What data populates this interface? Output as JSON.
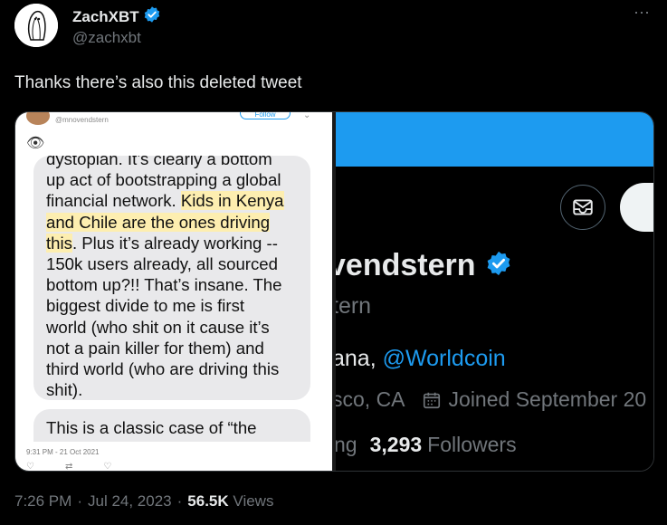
{
  "author": {
    "name": "ZachXBT",
    "handle": "@zachxbt",
    "verified": true
  },
  "tweet": {
    "text": "Thanks there’s also this deleted tweet",
    "time": "7:26 PM",
    "sep1": "·",
    "date": "Jul 24, 2023",
    "sep2": "·",
    "views_count": "56.5K",
    "views_label": "Views"
  },
  "more_icon": "⋯",
  "media_left": {
    "handle": "@mnovendstern",
    "follow_label": "Follow",
    "chevron": "⌄",
    "eye_icon": "👁",
    "bubble_lines": {
      "l1": "dystopian. It’s clearly a bottom",
      "l2": "up act of bootstrapping a global",
      "l3a": "financial network. ",
      "l3b": "Kids in Kenya",
      "l4": "and Chile are the ones driving",
      "l5a": "this",
      "l5b": ". Plus it’s already working --",
      "l6": "150k users already, all sourced",
      "l7": "bottom up?!! That’s insane. The",
      "l8": "biggest divide to me is first",
      "l9": "world (who shit on it cause it’s",
      "l10": "not a pain killer for them) and",
      "l11": "third world (who are driving this",
      "l12": "shit)."
    },
    "bubble2": "This is a classic case of “the",
    "timestamp": "9:31 PM - 21 Oct 2021",
    "actions": {
      "reply": "♡",
      "retweet": "⇄",
      "like": "♡"
    }
  },
  "media_right": {
    "name_partial": "vendstern",
    "handle_partial": "tern",
    "bio_prefix": "ana, ",
    "bio_link": "@Worldcoin",
    "location_partial": "sco, CA",
    "joined": "Joined September 20",
    "following_partial": "ng",
    "followers_count": "3,293",
    "followers_label": "Followers"
  },
  "colors": {
    "accent": "#1d9bf0",
    "muted": "#71767b",
    "text": "#e7e9ea",
    "highlight": "#fdeeb0"
  }
}
